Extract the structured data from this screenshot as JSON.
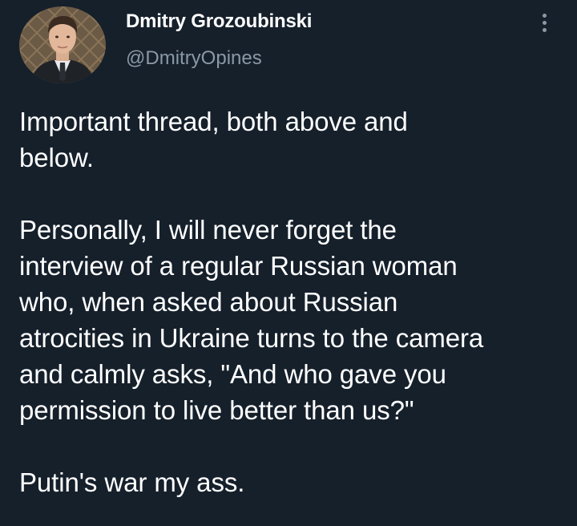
{
  "author": {
    "name": "Dmitry Grozoubinski",
    "handle": "@DmitryOpines",
    "avatar_icon": "profile-photo"
  },
  "menu": {
    "icon": "more-vertical-icon"
  },
  "tweet": {
    "paragraphs": [
      [
        "Important thread, both above and",
        "below."
      ],
      [
        "Personally, I will never forget the",
        "interview of a regular Russian woman",
        "who, when asked about Russian",
        "atrocities in Ukraine turns to the camera",
        "and calmly asks, \"And who gave you",
        "permission to live better than us?\""
      ],
      [
        "Putin's war my ass."
      ]
    ]
  },
  "colors": {
    "background": "#15202b",
    "text": "#ffffff",
    "secondary": "#8b98a5"
  }
}
